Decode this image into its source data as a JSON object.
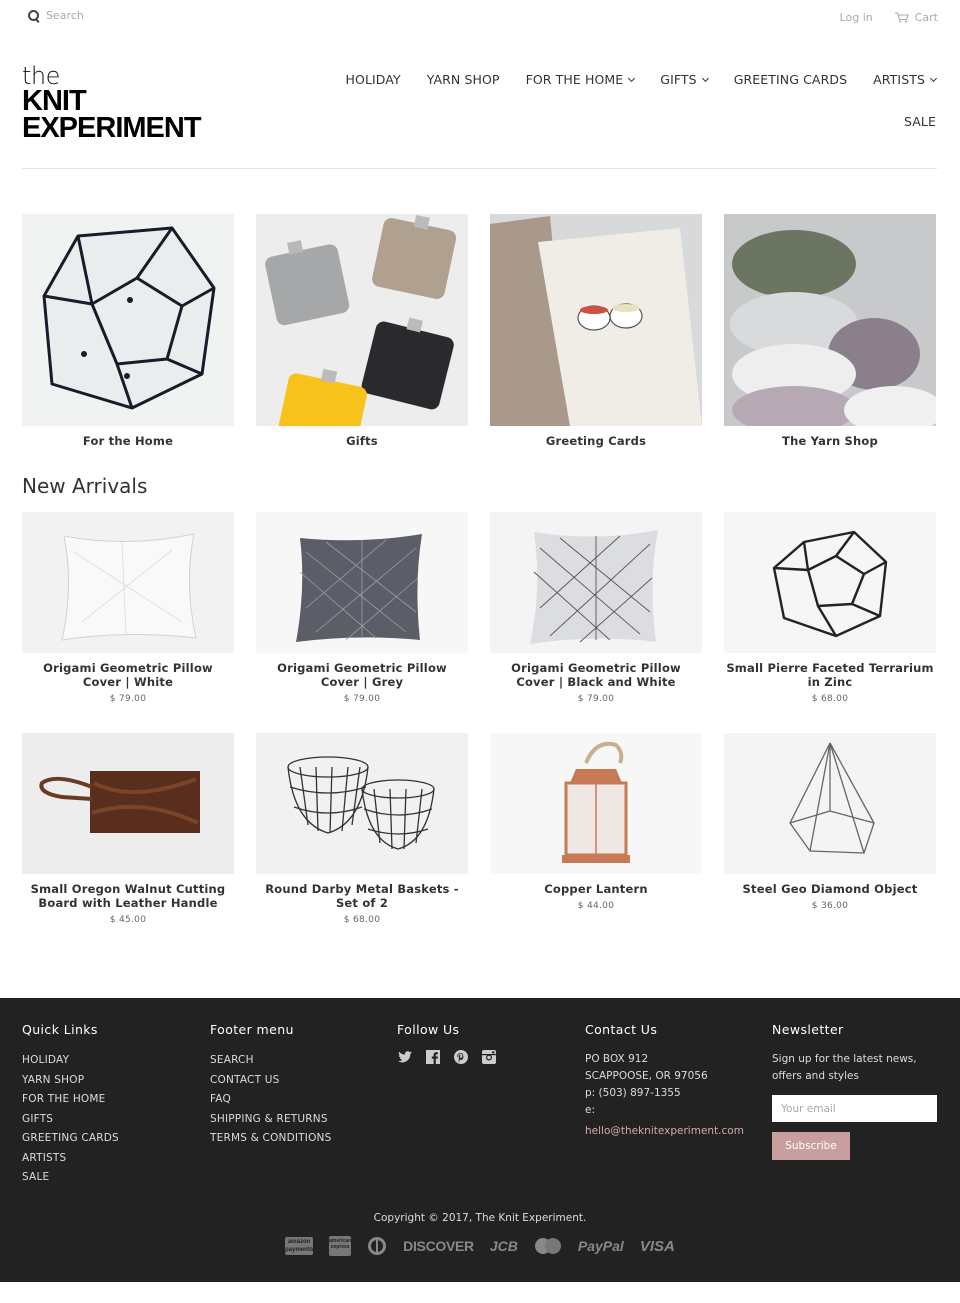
{
  "topbar": {
    "search_placeholder": "Search",
    "login_label": "Log in",
    "cart_label": "Cart"
  },
  "logo": {
    "line1": "the",
    "line2": "KNIT",
    "line3": "EXPERIMENT"
  },
  "nav": {
    "items": [
      {
        "label": "HOLIDAY",
        "dropdown": false
      },
      {
        "label": "YARN SHOP",
        "dropdown": false
      },
      {
        "label": "FOR THE HOME",
        "dropdown": true
      },
      {
        "label": "GIFTS",
        "dropdown": true
      },
      {
        "label": "GREETING CARDS",
        "dropdown": false
      },
      {
        "label": "ARTISTS",
        "dropdown": true
      },
      {
        "label": "SALE",
        "dropdown": false
      }
    ]
  },
  "collections": [
    {
      "title": "For the Home"
    },
    {
      "title": "Gifts"
    },
    {
      "title": "Greeting Cards"
    },
    {
      "title": "The Yarn Shop"
    }
  ],
  "new_arrivals": {
    "heading": "New Arrivals",
    "products": [
      {
        "title": "Origami Geometric Pillow Cover | White",
        "price": "$ 79.00"
      },
      {
        "title": "Origami Geometric Pillow Cover | Grey",
        "price": "$ 79.00"
      },
      {
        "title": "Origami Geometric Pillow Cover | Black and White",
        "price": "$ 79.00"
      },
      {
        "title": "Small Pierre Faceted Terrarium in Zinc",
        "price": "$ 68.00"
      },
      {
        "title": "Small Oregon Walnut Cutting Board with Leather Handle",
        "price": "$ 45.00"
      },
      {
        "title": "Round Darby Metal Baskets - Set of 2",
        "price": "$ 68.00"
      },
      {
        "title": "Copper Lantern",
        "price": "$ 44.00"
      },
      {
        "title": "Steel Geo Diamond Object",
        "price": "$ 36.00"
      }
    ]
  },
  "footer": {
    "quick_links": {
      "heading": "Quick Links",
      "items": [
        "HOLIDAY",
        "YARN SHOP",
        "FOR THE HOME",
        "GIFTS",
        "GREETING CARDS",
        "ARTISTS",
        "SALE"
      ]
    },
    "footer_menu": {
      "heading": "Footer menu",
      "items": [
        "SEARCH",
        "CONTACT US",
        "FAQ",
        "SHIPPING & RETURNS",
        "TERMS & CONDITIONS"
      ]
    },
    "follow": {
      "heading": "Follow Us",
      "icons": [
        "twitter-icon",
        "facebook-icon",
        "pinterest-icon",
        "instagram-icon"
      ]
    },
    "contact": {
      "heading": "Contact Us",
      "address1": "PO BOX 912",
      "address2": "SCAPPOOSE, OR 97056",
      "phone": "p: (503) 897-1355",
      "email_label": "e:",
      "email": "hello@theknitexperiment.com"
    },
    "newsletter": {
      "heading": "Newsletter",
      "text": "Sign up for the latest news, offers and styles",
      "placeholder": "Your email",
      "button": "Subscribe"
    },
    "copyright": "Copyright © 2017, The Knit Experiment.",
    "payments": [
      "amazon payments",
      "american express",
      "diners",
      "DISCOVER",
      "JCB",
      "MasterCard",
      "PayPal",
      "VISA"
    ]
  },
  "colors": {
    "footer_bg": "#222222",
    "accent": "#c99e9e",
    "email_link": "#d9a7a7"
  }
}
